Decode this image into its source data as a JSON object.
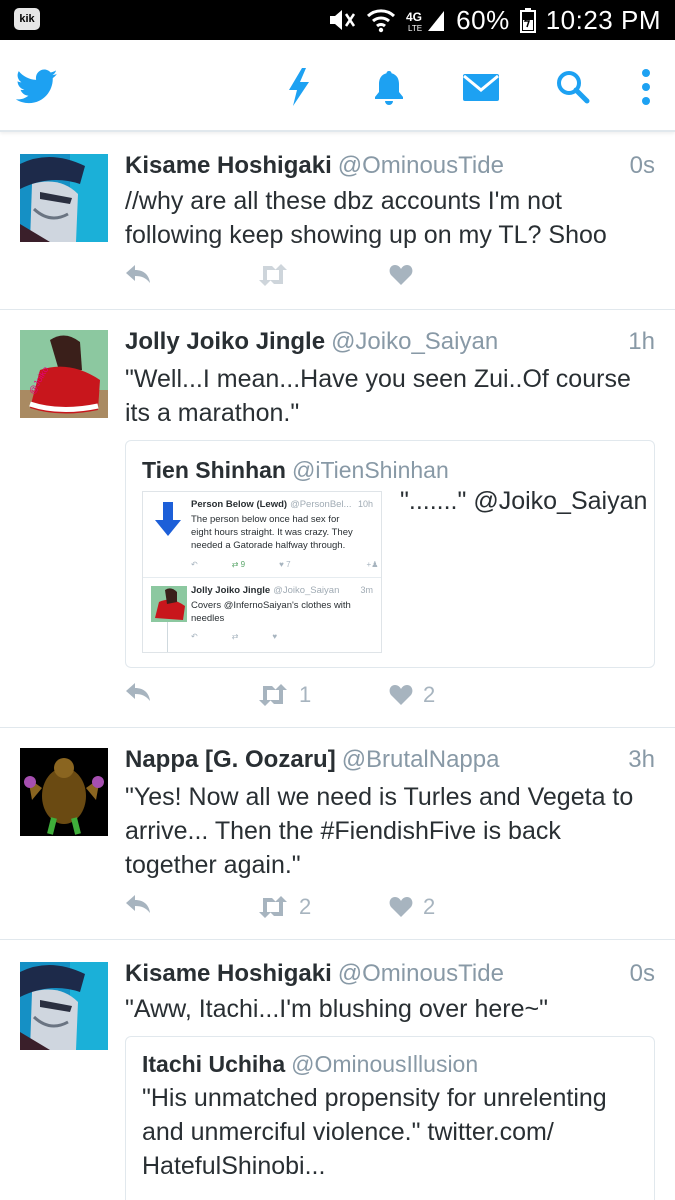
{
  "status_bar": {
    "app_icon": "kik",
    "battery": "60%",
    "time": "10:23 PM",
    "network": "4G LTE"
  },
  "app_bar": {
    "icons": [
      "twitter-bird-icon",
      "lightning-icon",
      "bell-icon",
      "mail-icon",
      "search-icon",
      "overflow-menu-icon"
    ],
    "accent": "#1da1f2"
  },
  "tweets": [
    {
      "name": "Kisame Hoshigaki",
      "handle": "@OminousTide",
      "time": "0s",
      "text_lines": [
        "//why are all these dbz accounts I'm not",
        "following keep showing up on my TL? Shoo"
      ],
      "retweets": "",
      "likes": ""
    },
    {
      "name": "Jolly Joiko Jingle",
      "handle": "@Joiko_Saiyan",
      "time": "1h",
      "text_lines": [
        "\"Well...I mean...Have you seen Zui..Of course",
        "its a marathon.\""
      ],
      "quote": {
        "name": "Tien Shinhan",
        "handle": "@iTienShinhan",
        "side_text": "\".......\" @Joiko_Saiyan",
        "embedded": [
          {
            "name": "Person Below (Lewd)",
            "handle": "@PersonBel...",
            "time": "10h",
            "text_lines": [
              "The person below once had sex for",
              "eight hours straight. It was crazy. They",
              "needed a Gatorade halfway through."
            ],
            "retweets": "9",
            "likes": "7"
          },
          {
            "name": "Jolly Joiko Jingle",
            "handle": "@Joiko_Saiyan",
            "time": "3m",
            "text_lines": [
              "Covers @InfernoSaiyan's clothes with",
              "needles"
            ]
          }
        ]
      },
      "retweets": "1",
      "likes": "2"
    },
    {
      "name": "Nappa [G. Oozaru]",
      "handle": "@BrutalNappa",
      "time": "3h",
      "text_lines": [
        "\"Yes! Now all we need is Turles and Vegeta to",
        "arrive... Then the #FiendishFive is back",
        "together again.\""
      ],
      "retweets": "2",
      "likes": "2"
    },
    {
      "name": "Kisame Hoshigaki",
      "handle": "@OminousTide",
      "time": "0s",
      "text_lines": [
        "\"Aww, Itachi...I'm blushing over here~\""
      ],
      "quote": {
        "name": "Itachi Uchiha",
        "handle": "@OminousIllusion",
        "text_lines": [
          "\"His unmatched propensity for unrelenting",
          "and unmerciful violence.\" twitter.com/",
          "HatefulShinobi..."
        ]
      }
    }
  ]
}
